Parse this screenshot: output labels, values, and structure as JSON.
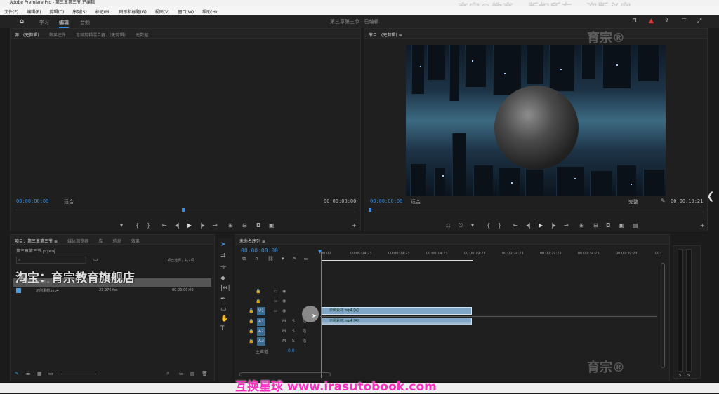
{
  "window": {
    "title": "Adobe Premiere Pro - 第三章第三节 已编辑"
  },
  "menu": [
    "文件(F)",
    "编辑(E)",
    "剪辑(C)",
    "序列(S)",
    "标记(M)",
    "图形和标题(G)",
    "视图(V)",
    "窗口(W)",
    "帮助(H)"
  ],
  "watermark_top": "育宗®教育 - 版权所有 - 盗版必究",
  "workspace": {
    "tabs": [
      "学习",
      "编辑",
      "音频"
    ],
    "active": "编辑",
    "project_title": "第三章第三节 · 已编辑"
  },
  "source_panel": {
    "tabs": [
      "源：(无剪辑)",
      "效果控件",
      "音频剪辑混合器：(无剪辑)",
      "元数据"
    ],
    "timecode_left": "00:00:00:00",
    "zoom": "适合",
    "timecode_right": "00:00:00:00"
  },
  "program_panel": {
    "tabs": [
      "节目：(无剪辑) ≡"
    ],
    "timecode_left": "00:00:00:00",
    "zoom": "适合",
    "quality": "完整",
    "timecode_right": "00:00:19:21"
  },
  "project_panel": {
    "tabs": [
      "项目：第三章第三节 ≡",
      "媒体浏览器",
      "库",
      "信息",
      "效果"
    ],
    "path": "第三章第三节.prproj",
    "search_placeholder": "",
    "status": "1项已选择，共2项",
    "items": [
      {
        "name": "第三章第三节 ≡",
        "rate": "",
        "start": ""
      },
      {
        "name": "示例素材.mp4",
        "rate": "23.976 fps",
        "start": "00:00:00:00"
      }
    ]
  },
  "taobao_watermark": "淘宝：育宗教育旗舰店",
  "timeline": {
    "tab": "未命名序列 ≡",
    "timecode": "00:00:00:00",
    "ruler": [
      "00:00",
      "00:00:04:23",
      "00:00:09:23",
      "00:00:14:23",
      "00:00:19:23",
      "00:00:24:23",
      "00:00:29:23",
      "00:00:34:23",
      "00:00:39:23",
      "00:"
    ],
    "tracks": [
      {
        "id": "V3"
      },
      {
        "id": "V2"
      },
      {
        "id": "V1"
      },
      {
        "id": "A1"
      },
      {
        "id": "A2"
      },
      {
        "id": "A3"
      }
    ],
    "master": {
      "label": "主声道",
      "value": "0.0"
    },
    "clips": [
      {
        "label": "示例素材.mp4 [V]",
        "track": "V1"
      },
      {
        "label": "示例素材.mp4 [A]",
        "track": "A1"
      }
    ]
  },
  "meters": {
    "labels": [
      "S",
      "S"
    ]
  },
  "logo_watermark": "育宗®",
  "bottom_watermark": "互换星球 www.irasutobook.com"
}
